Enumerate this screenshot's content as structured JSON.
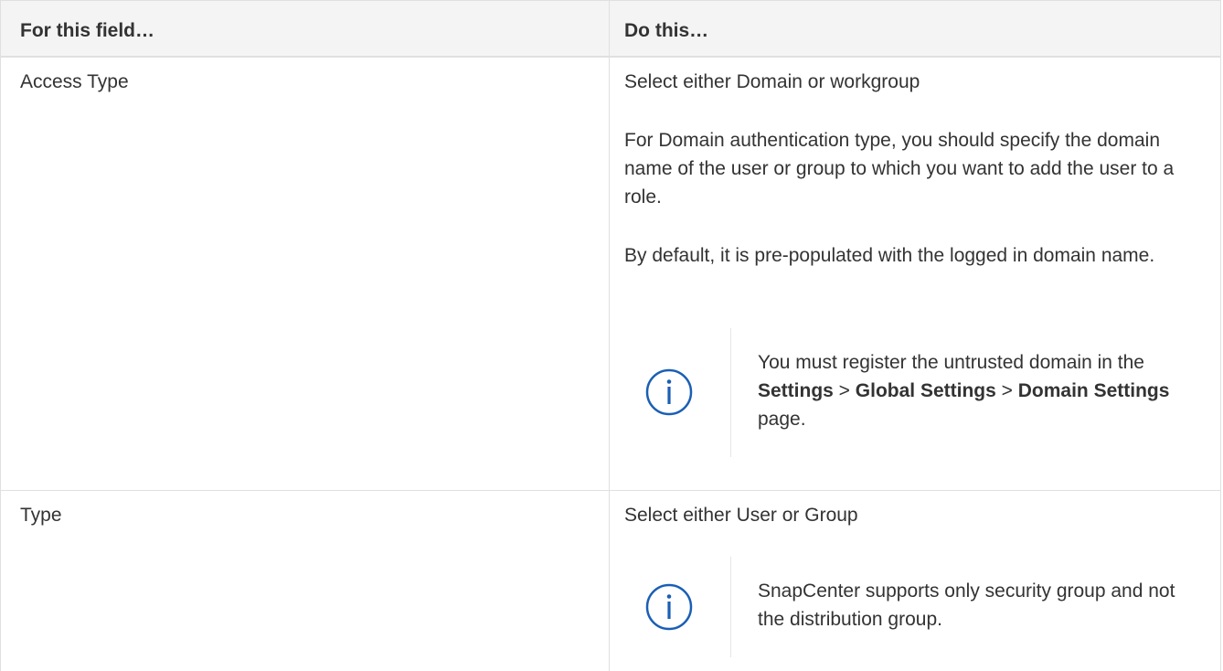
{
  "table": {
    "headers": {
      "field": "For this field…",
      "action": "Do this…"
    },
    "rows": [
      {
        "field": "Access Type",
        "paragraphs": [
          "Select either Domain or workgroup",
          "For Domain authentication type, you should specify the domain name of the user or group to which you want to add the user to a role.",
          "By default, it is pre-populated with the logged in domain name."
        ],
        "note": {
          "icon": "info-icon",
          "text_before": "You must register the untrusted domain in the ",
          "settings": "Settings",
          "sep1": " > ",
          "global_settings": "Global Settings",
          "sep2": " > ",
          "domain_settings": "Domain Settings",
          "text_after": " page."
        }
      },
      {
        "field": "Type",
        "paragraphs": [
          "Select either User or Group"
        ],
        "note": {
          "icon": "info-icon",
          "text": "SnapCenter supports only security group and not the distribution group."
        }
      }
    ]
  },
  "colors": {
    "text": "#333333",
    "border": "#e0e0e0",
    "header_bg": "#f4f4f4",
    "info_icon": "#1a5fb4"
  }
}
